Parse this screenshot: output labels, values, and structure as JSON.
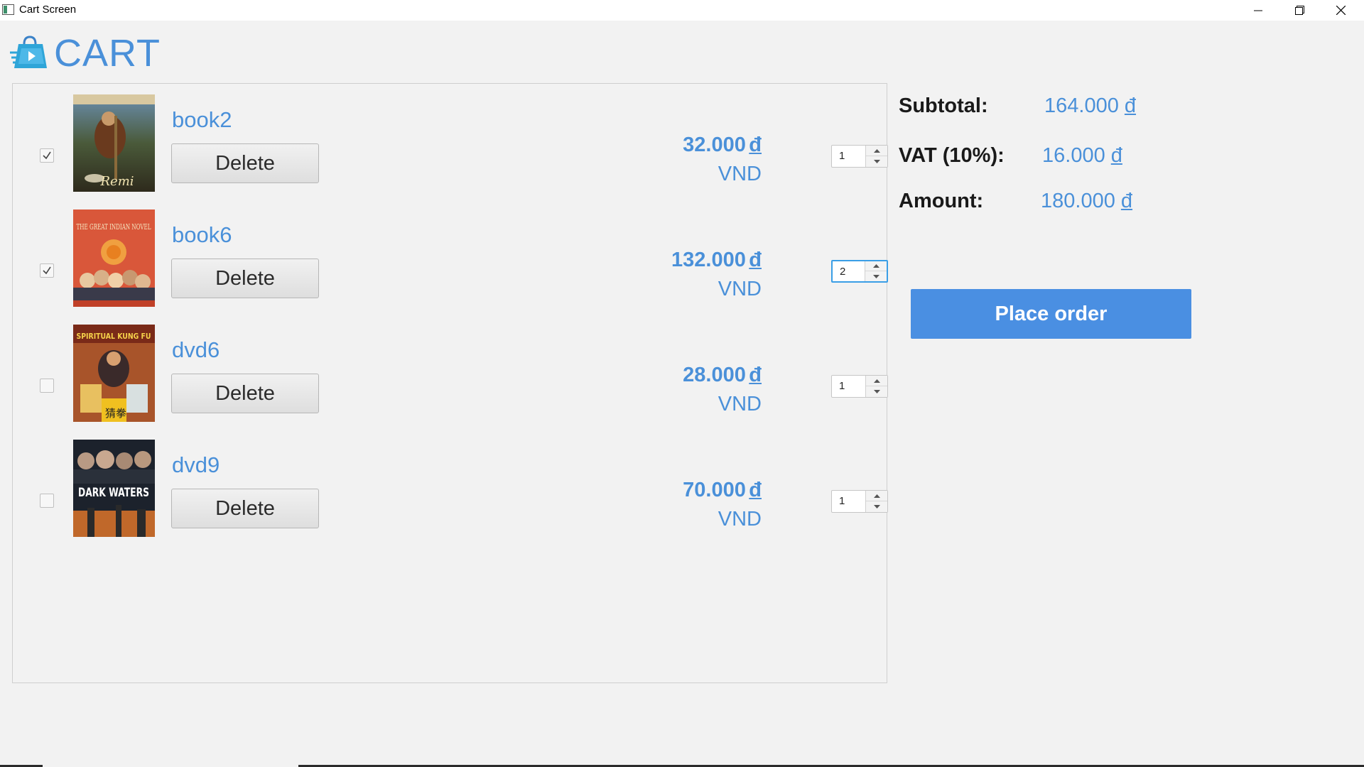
{
  "window": {
    "title": "Cart Screen"
  },
  "header": {
    "title": "CART",
    "logo_icon": "shopping-bag-fast-icon"
  },
  "colors": {
    "accent": "#4a90d9",
    "button_primary": "#4a8fe2"
  },
  "items": [
    {
      "name": "book2",
      "checked": true,
      "delete_label": "Delete",
      "price": "32.000",
      "dong": "đ",
      "currency": "VND",
      "quantity": "1",
      "cover_title": "Remi"
    },
    {
      "name": "book6",
      "checked": true,
      "delete_label": "Delete",
      "price": "132.000",
      "dong": "đ",
      "currency": "VND",
      "quantity": "2",
      "cover_title": "THE GREAT INDIAN NOVEL"
    },
    {
      "name": "dvd6",
      "checked": false,
      "delete_label": "Delete",
      "price": "28.000",
      "dong": "đ",
      "currency": "VND",
      "quantity": "1",
      "cover_title": "SPIRITUAL KUNG FU"
    },
    {
      "name": "dvd9",
      "checked": false,
      "delete_label": "Delete",
      "price": "70.000",
      "dong": "đ",
      "currency": "VND",
      "quantity": "1",
      "cover_title": "DARK WATERS"
    }
  ],
  "summary": {
    "subtotal_label": "Subtotal:",
    "subtotal_value": "164.000",
    "vat_label": "VAT (10%):",
    "vat_value": "16.000",
    "amount_label": "Amount:",
    "amount_value": "180.000",
    "dong": "đ",
    "place_order_label": "Place order"
  }
}
